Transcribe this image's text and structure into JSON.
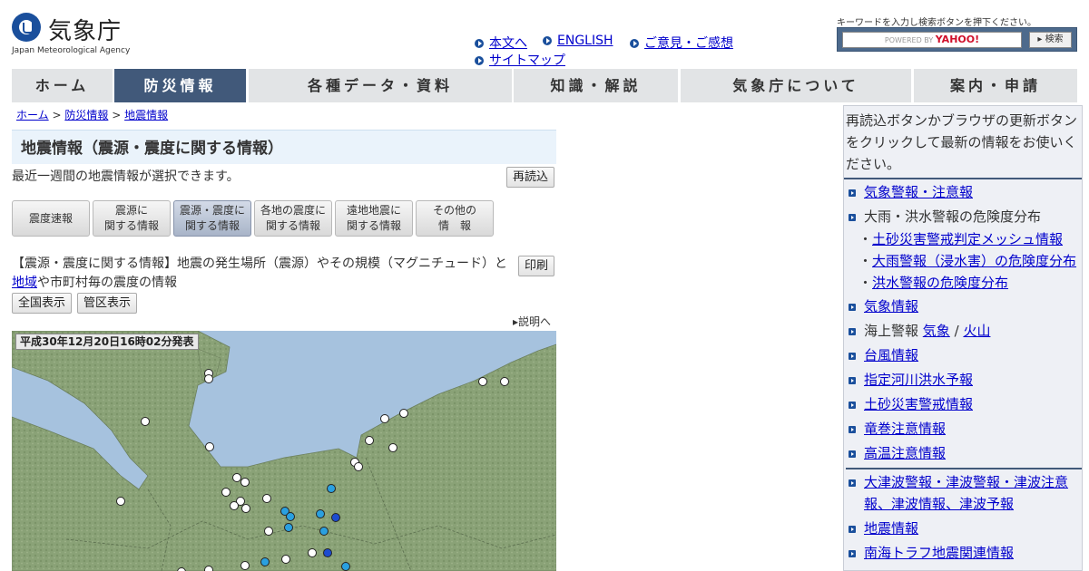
{
  "header": {
    "logo_title": "気象庁",
    "logo_subtitle": "Japan Meteorological Agency",
    "links": [
      "本文へ",
      "ENGLISH",
      "ご意見・ご感想",
      "サイトマップ"
    ],
    "search_note": "キーワードを入力し検索ボタンを押下ください。",
    "search_powered": "POWERED BY",
    "search_brand": "YAHOO!",
    "search_button": "▸ 検索"
  },
  "nav": {
    "tabs": [
      "ホーム",
      "防災情報",
      "各種データ・資料",
      "知識・解説",
      "気象庁について",
      "案内・申請"
    ],
    "active_index": 1
  },
  "breadcrumb": {
    "items": [
      "ホーム",
      "防災情報",
      "地震情報"
    ],
    "separator": ">"
  },
  "main": {
    "title": "地震情報（震源・震度に関する情報）",
    "intro": "最近一週間の地震情報が選択できます。",
    "reload_button": "再読込",
    "subtabs": [
      {
        "line1": "震度速報",
        "line2": ""
      },
      {
        "line1": "震源に",
        "line2": "関する情報"
      },
      {
        "line1": "震源・震度に",
        "line2": "関する情報"
      },
      {
        "line1": "各地の震度に",
        "line2": "関する情報"
      },
      {
        "line1": "遠地地震に",
        "line2": "関する情報"
      },
      {
        "line1": "その他の",
        "line2": "情　報"
      }
    ],
    "active_subtab": 2,
    "desc_part1": "【震源・震度に関する情報】地震の発生場所（震源）やその規模（マグニチュード）と",
    "desc_link": "地域",
    "desc_part2": "や市町村毎の震度の情報",
    "print_button": "印刷",
    "view_national": "全国表示",
    "view_district": "管区表示",
    "explain_link": "説明へ",
    "map_timestamp": "平成30年12月20日16時02分発表"
  },
  "sidebar": {
    "note": "再読込ボタンかブラウザの更新ボタンをクリックして最新の情報をお使いください。",
    "warnings_link": "気象警報・注意報",
    "heavy_rain_label": "大雨・洪水警報の危険度分布",
    "sub_items": [
      "土砂災害警戒判定メッシュ情報",
      "大雨警報（浸水害）の危険度分布",
      "洪水警報の危険度分布"
    ],
    "weather_info_link": "気象情報",
    "marine_label": "海上警報",
    "marine_links": [
      "気象",
      "火山"
    ],
    "marine_separator": "/",
    "links_group1": [
      "台風情報",
      "指定河川洪水予報",
      "土砂災害警戒情報",
      "竜巻注意情報",
      "高温注意情報"
    ],
    "links_group2": [
      "大津波警報・津波警報・津波注意報、津波情報、津波予報",
      "地震情報",
      "南海トラフ地震関連情報"
    ]
  }
}
